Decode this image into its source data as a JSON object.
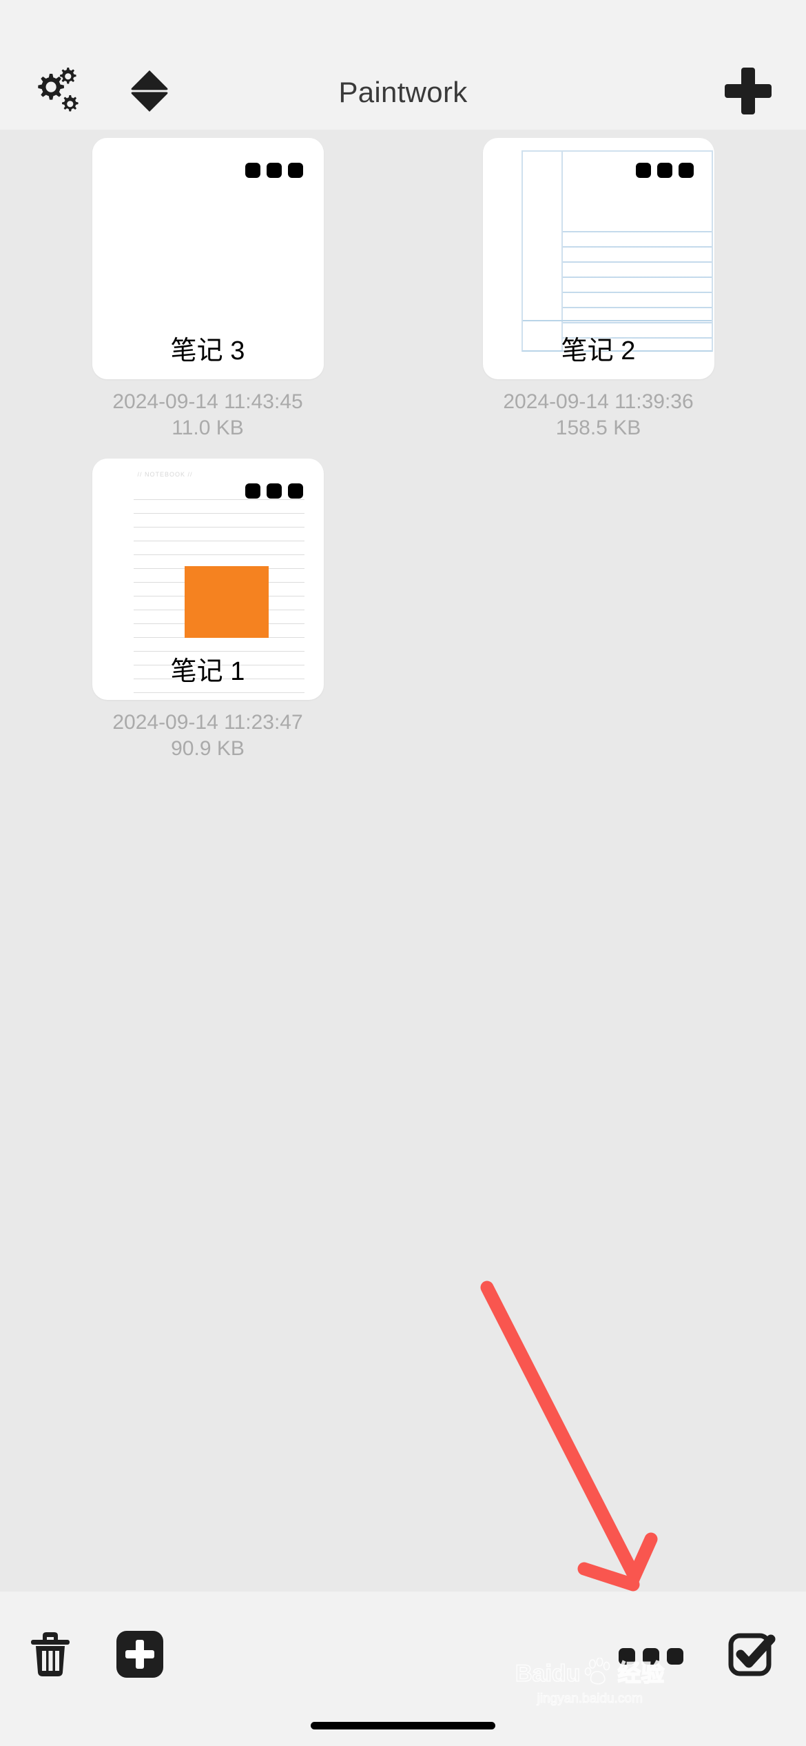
{
  "app": {
    "title": "Paintwork"
  },
  "header": {
    "settings_icon": "gears-icon",
    "sort_icon": "sort-updown-icon",
    "add_icon": "plus-icon"
  },
  "notes": [
    {
      "title": "笔记 3",
      "meta": "2024-09-14 11:43:45 11.0 KB",
      "date": "2024-09-14",
      "time": "11:43:45",
      "size": "11.0 KB",
      "thumbnail": "blank-page",
      "menu_icon": "more-options-icon"
    },
    {
      "title": "笔记 2",
      "meta": "2024-09-14 11:39:36 158.5 KB",
      "date": "2024-09-14",
      "time": "11:39:36",
      "size": "158.5 KB",
      "thumbnail": "blue-ruled-page",
      "menu_icon": "more-options-icon"
    },
    {
      "title": "笔记 1",
      "meta": "2024-09-14 11:23:47 90.9 KB",
      "date": "2024-09-14",
      "time": "11:23:47",
      "size": "90.9 KB",
      "thumbnail": "lined-notebook-with-orange-rect",
      "notebook_header": "// NOTEBOOK //",
      "menu_icon": "more-options-icon"
    }
  ],
  "toolbar": {
    "delete_icon": "trash-icon",
    "add_icon": "add-square-icon",
    "more_icon": "more-options-icon",
    "select_icon": "checkbox-checked-icon"
  },
  "annotation": {
    "arrow_color": "#f9564f",
    "arrow_name": "red-pointer-arrow"
  },
  "watermark": {
    "brand": "Baidu",
    "suffix": "经验",
    "url": "jingyan.baidu.com"
  },
  "colors": {
    "background": "#e9e9e9",
    "chrome": "#f2f2f2",
    "card": "#ffffff",
    "meta_text": "#aaaaaa",
    "accent_orange": "#f58220",
    "arrow_red": "#f9564f",
    "rule_blue": "#b9d4e8"
  }
}
